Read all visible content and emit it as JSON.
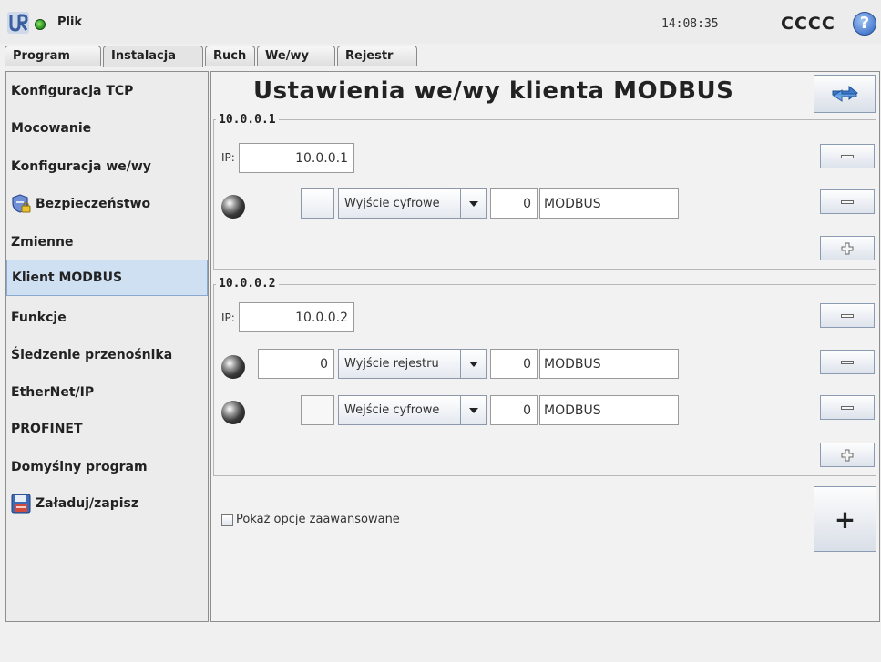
{
  "header": {
    "file_menu": "Plik",
    "time": "14:08:35",
    "robot_name": "CCCC",
    "help": "?"
  },
  "tabs": [
    "Program",
    "Instalacja",
    "Ruch",
    "We/wy",
    "Rejestr"
  ],
  "active_tab": "Instalacja",
  "sidebar": {
    "items": [
      {
        "label": "Konfiguracja TCP"
      },
      {
        "label": "Mocowanie"
      },
      {
        "label": "Konfiguracja we/wy"
      },
      {
        "label": "Bezpieczeństwo",
        "icon": "safety-shield-icon"
      },
      {
        "label": "Zmienne"
      },
      {
        "label": "Klient MODBUS",
        "selected": true
      },
      {
        "label": "Funkcje"
      },
      {
        "label": "Śledzenie przenośnika"
      },
      {
        "label": "EtherNet/IP"
      },
      {
        "label": "PROFINET"
      },
      {
        "label": "Domyślny program"
      },
      {
        "label": "Załaduj/zapisz",
        "icon": "floppy-disk-icon"
      }
    ]
  },
  "main": {
    "title": "Ustawienia we/wy klienta MODBUS",
    "ip_label": "IP:",
    "servers": [
      {
        "name": "10.0.0.1",
        "ip": "10.0.0.1",
        "signals": [
          {
            "value": "",
            "type": "Wyjście cyfrowe",
            "address": "0",
            "name": "MODBUS"
          }
        ]
      },
      {
        "name": "10.0.0.2",
        "ip": "10.0.0.2",
        "signals": [
          {
            "value": "0",
            "type": "Wyjście rejestru",
            "address": "0",
            "name": "MODBUS"
          },
          {
            "value": "",
            "type": "Wejście cyfrowe",
            "address": "0",
            "name": "MODBUS"
          }
        ]
      }
    ],
    "advanced_checkbox_label": "Pokaż opcje zaawansowane",
    "advanced_checked": false,
    "add_client_label": "+"
  }
}
